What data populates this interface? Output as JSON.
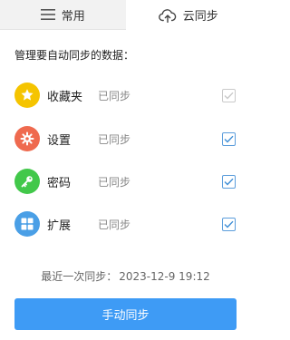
{
  "tabs": [
    {
      "label": "常用",
      "icon": "menu-icon",
      "active": false
    },
    {
      "label": "云同步",
      "icon": "cloud-upload-icon",
      "active": true
    }
  ],
  "section_title": "管理要自动同步的数据：",
  "items": [
    {
      "label": "收藏夹",
      "status": "已同步",
      "icon": "star-icon",
      "color": "#f5c400",
      "checked": true,
      "disabled": true
    },
    {
      "label": "设置",
      "status": "已同步",
      "icon": "gear-icon",
      "color": "#ef6a4f",
      "checked": true,
      "disabled": false
    },
    {
      "label": "密码",
      "status": "已同步",
      "icon": "key-icon",
      "color": "#42c84a",
      "checked": true,
      "disabled": false
    },
    {
      "label": "扩展",
      "status": "已同步",
      "icon": "extensions-grid-icon",
      "color": "#4a9fe6",
      "checked": true,
      "disabled": false
    }
  ],
  "last_sync": {
    "label": "最近一次同步：",
    "value": "2023-12-9 19:12"
  },
  "sync_button_label": "手动同步"
}
